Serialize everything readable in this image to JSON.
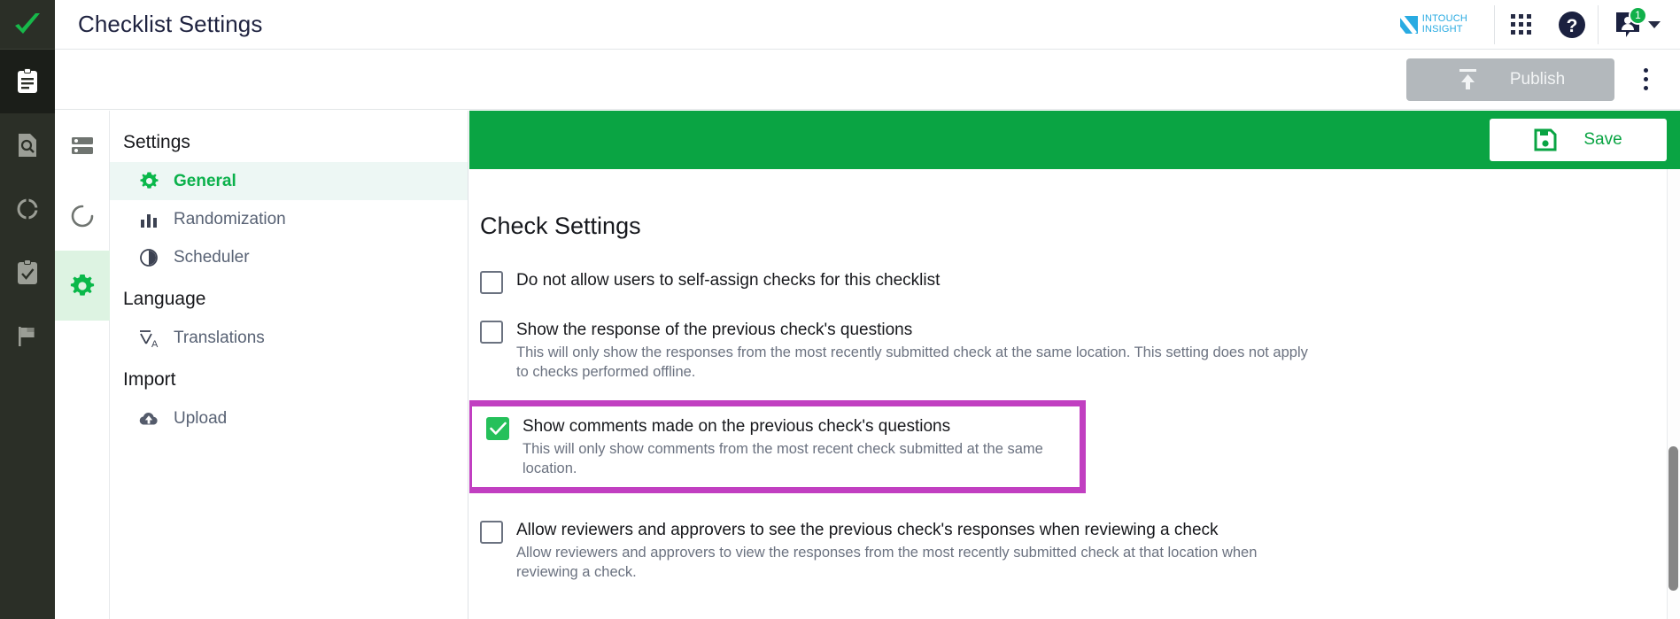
{
  "header": {
    "title": "Checklist Settings",
    "brand": {
      "line1": "INTOUCH",
      "line2": "INSIGHT",
      "color": "#29abe2"
    },
    "apps_label": "apps-grid",
    "help_label": "help",
    "account_badge": "1"
  },
  "action_bar": {
    "publish_label": "Publish",
    "publish_disabled": true,
    "more_label": "More options"
  },
  "rail": {
    "logo": "checkmark-logo",
    "items": [
      {
        "name": "clipboard",
        "active": true
      },
      {
        "name": "document-search",
        "active": false
      },
      {
        "name": "donut-chart",
        "active": false
      },
      {
        "name": "clipboard-check",
        "active": false
      },
      {
        "name": "flag",
        "active": false
      }
    ]
  },
  "settings_rail": {
    "items": [
      {
        "name": "list-panel",
        "active": false
      },
      {
        "name": "refresh-circle",
        "active": false
      },
      {
        "name": "gear",
        "active": true
      }
    ]
  },
  "settings_nav": {
    "groups": [
      {
        "title": "Settings",
        "items": [
          {
            "label": "General",
            "icon": "gear-icon",
            "active": true
          },
          {
            "label": "Randomization",
            "icon": "bar-chart-icon",
            "active": false
          },
          {
            "label": "Scheduler",
            "icon": "clock-icon",
            "active": false
          }
        ]
      },
      {
        "title": "Language",
        "items": [
          {
            "label": "Translations",
            "icon": "translate-icon",
            "active": false
          }
        ]
      },
      {
        "title": "Import",
        "items": [
          {
            "label": "Upload",
            "icon": "cloud-upload-icon",
            "active": false
          }
        ]
      }
    ]
  },
  "save_bar": {
    "save_label": "Save",
    "bar_color": "#0aa443"
  },
  "main": {
    "section_title": "Check Settings",
    "highlight_color": "#c13fc1",
    "options": [
      {
        "label": "Do not allow users to self-assign checks for this checklist",
        "description": "",
        "checked": false,
        "highlighted": false
      },
      {
        "label": "Show the response of the previous check's questions",
        "description": "This will only show the responses from the most recently submitted check at the same location. This setting does not apply to checks performed offline.",
        "checked": false,
        "highlighted": false
      },
      {
        "label": "Show comments made on the previous check's questions",
        "description": "This will only show comments from the most recent check submitted at the same location.",
        "checked": true,
        "highlighted": true
      },
      {
        "label": "Allow reviewers and approvers to see the previous check's responses when reviewing a check",
        "description": "Allow reviewers and approvers to view the responses from the most recently submitted check at that location when reviewing a check.",
        "checked": false,
        "highlighted": false
      }
    ]
  }
}
